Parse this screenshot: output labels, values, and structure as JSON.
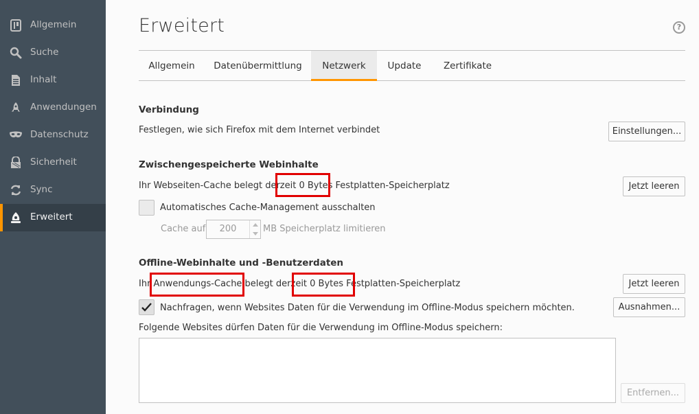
{
  "sidebar": {
    "items": [
      {
        "label": "Allgemein",
        "icon": "general-icon"
      },
      {
        "label": "Suche",
        "icon": "search-icon"
      },
      {
        "label": "Inhalt",
        "icon": "content-icon"
      },
      {
        "label": "Anwendungen",
        "icon": "applications-icon"
      },
      {
        "label": "Datenschutz",
        "icon": "privacy-mask-icon"
      },
      {
        "label": "Sicherheit",
        "icon": "security-icon"
      },
      {
        "label": "Sync",
        "icon": "sync-icon"
      },
      {
        "label": "Erweitert",
        "icon": "advanced-icon"
      }
    ],
    "active": "Erweitert"
  },
  "header": {
    "title": "Erweitert",
    "help": "?"
  },
  "tabs": [
    {
      "label": "Allgemein"
    },
    {
      "label": "Datenübermittlung"
    },
    {
      "label": "Netzwerk"
    },
    {
      "label": "Update"
    },
    {
      "label": "Zertifikate"
    }
  ],
  "active_tab": "Netzwerk",
  "connection": {
    "heading": "Verbindung",
    "description": "Festlegen, wie sich Firefox mit dem Internet verbindet",
    "settings_button": "Einstellungen..."
  },
  "cache": {
    "heading": "Zwischengespeicherte Webinhalte",
    "description": "Ihr Webseiten-Cache belegt derzeit 0 Bytes Festplatten-Speicherplatz",
    "clear_button": "Jetzt leeren",
    "override_label": "Automatisches Cache-Management ausschalten",
    "override_checked": false,
    "limit_prefix": "Cache auf",
    "limit_value": "200",
    "limit_suffix": "MB Speicherplatz limitieren"
  },
  "offline": {
    "heading": "Offline-Webinhalte und -Benutzerdaten",
    "description": "Ihr Anwendungs-Cache belegt derzeit 0 Bytes Festplatten-Speicherplatz",
    "clear_button": "Jetzt leeren",
    "notify_label": "Nachfragen, wenn Websites Daten für die Verwendung im Offline-Modus speichern möchten.",
    "notify_checked": true,
    "exceptions_button": "Ausnahmen...",
    "list_label": "Folgende Websites dürfen Daten für die Verwendung im Offline-Modus speichern:",
    "remove_button": "Entfernen..."
  },
  "colors": {
    "sidebar_bg": "#424f5a",
    "accent": "#ff9500",
    "highlight": "#e10000"
  }
}
